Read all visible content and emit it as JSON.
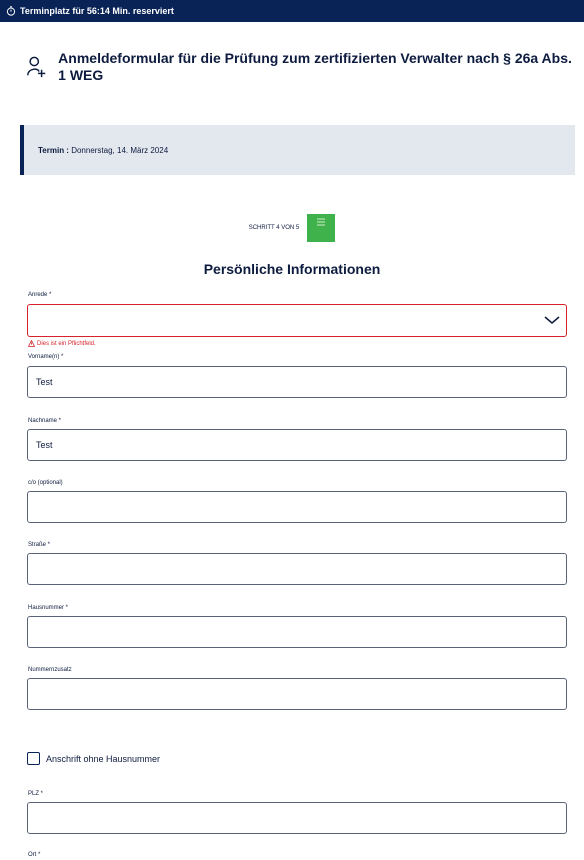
{
  "topbar": {
    "timer_icon": "stopwatch-icon",
    "text": "Terminplatz für 56:14 Min. reserviert"
  },
  "header": {
    "icon": "add-person-icon",
    "title": "Anmeldeformular für die Prüfung zum zertifizierten Verwalter nach § 26a Abs. 1 WEG"
  },
  "appointment": {
    "label": "Termin :",
    "value": " Donnerstag, 14. März 2024"
  },
  "step": {
    "text": "SCHRITT 4 VON 5",
    "icon": "form-list-icon",
    "color": "#3fb24b"
  },
  "section_title": "Persönliche Informationen",
  "form": {
    "anrede": {
      "label": "Anrede *",
      "value": "",
      "error": "Dies ist ein Pflichtfeld.",
      "error_icon": "warning-icon"
    },
    "vorname": {
      "label": "Vorname(n) *",
      "value": "Test"
    },
    "nachname": {
      "label": "Nachname *",
      "value": "Test"
    },
    "co": {
      "label": "c/o (optional)",
      "value": ""
    },
    "strasse": {
      "label": "Straße *",
      "value": ""
    },
    "hausnummer": {
      "label": "Hausnummer *",
      "value": ""
    },
    "nummernzusatz": {
      "label": "Nummernzusatz",
      "value": ""
    },
    "ohne_hausnummer": {
      "label": "Anschrift ohne Hausnummer",
      "checked": false
    },
    "plz": {
      "label": "PLZ *",
      "value": ""
    },
    "ort": {
      "label": "Ort *"
    }
  },
  "colors": {
    "topbar": "#0a2357",
    "error": "#d6232b",
    "banner": "#e3e8ef"
  }
}
